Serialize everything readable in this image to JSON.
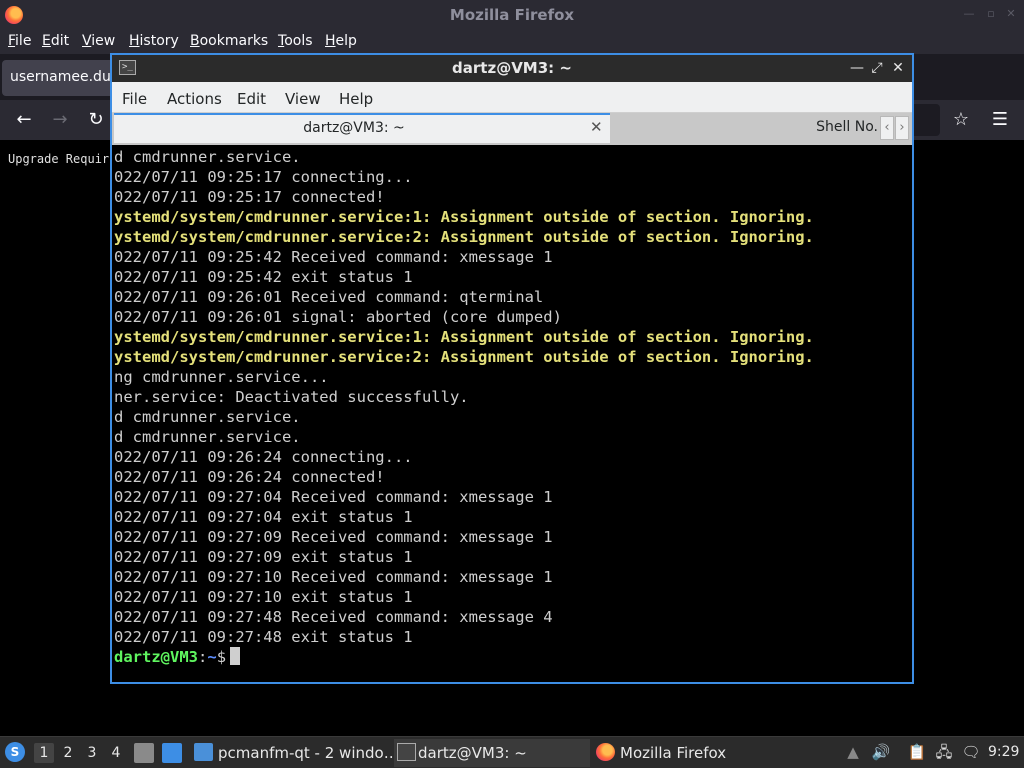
{
  "firefox": {
    "title": "Mozilla Firefox",
    "menu": [
      "File",
      "Edit",
      "View",
      "History",
      "Bookmarks",
      "Tools",
      "Help"
    ],
    "tab_label": "usernamee.duc",
    "page_text": "Upgrade Requir"
  },
  "terminal": {
    "title": "dartz@VM3: ~",
    "menu": [
      "File",
      "Actions",
      "Edit",
      "View",
      "Help"
    ],
    "tab_active_label": "dartz@VM3: ~",
    "tab_second_label": "Shell No.",
    "lines": [
      {
        "text": "d cmdrunner.service.",
        "style": "normal"
      },
      {
        "text": "022/07/11 09:25:17 connecting...",
        "style": "normal"
      },
      {
        "text": "022/07/11 09:25:17 connected!",
        "style": "normal"
      },
      {
        "text": "ystemd/system/cmdrunner.service:1: Assignment outside of section. Ignoring.",
        "style": "warn"
      },
      {
        "text": "ystemd/system/cmdrunner.service:2: Assignment outside of section. Ignoring.",
        "style": "warn"
      },
      {
        "text": "022/07/11 09:25:42 Received command: xmessage 1",
        "style": "normal"
      },
      {
        "text": "022/07/11 09:25:42 exit status 1",
        "style": "normal"
      },
      {
        "text": "022/07/11 09:26:01 Received command: qterminal",
        "style": "normal"
      },
      {
        "text": "022/07/11 09:26:01 signal: aborted (core dumped)",
        "style": "normal"
      },
      {
        "text": "ystemd/system/cmdrunner.service:1: Assignment outside of section. Ignoring.",
        "style": "warn"
      },
      {
        "text": "ystemd/system/cmdrunner.service:2: Assignment outside of section. Ignoring.",
        "style": "warn"
      },
      {
        "text": "ng cmdrunner.service...",
        "style": "normal"
      },
      {
        "text": "ner.service: Deactivated successfully.",
        "style": "normal"
      },
      {
        "text": "d cmdrunner.service.",
        "style": "normal"
      },
      {
        "text": "d cmdrunner.service.",
        "style": "normal"
      },
      {
        "text": "022/07/11 09:26:24 connecting...",
        "style": "normal"
      },
      {
        "text": "022/07/11 09:26:24 connected!",
        "style": "normal"
      },
      {
        "text": "022/07/11 09:27:04 Received command: xmessage 1",
        "style": "normal"
      },
      {
        "text": "022/07/11 09:27:04 exit status 1",
        "style": "normal"
      },
      {
        "text": "022/07/11 09:27:09 Received command: xmessage 1",
        "style": "normal"
      },
      {
        "text": "022/07/11 09:27:09 exit status 1",
        "style": "normal"
      },
      {
        "text": "022/07/11 09:27:10 Received command: xmessage 1",
        "style": "normal"
      },
      {
        "text": "022/07/11 09:27:10 exit status 1",
        "style": "normal"
      },
      {
        "text": "022/07/11 09:27:48 Received command: xmessage 4",
        "style": "normal"
      },
      {
        "text": "022/07/11 09:27:48 exit status 1",
        "style": "normal"
      }
    ],
    "prompt": {
      "user": "dartz@VM3",
      "sep": ":",
      "path": "~",
      "symbol": "$"
    }
  },
  "taskbar": {
    "workspaces": [
      "1",
      "2",
      "3",
      "4"
    ],
    "tasks": [
      {
        "label": "pcmanfm-qt - 2 windo…",
        "icon": "folder-icon"
      },
      {
        "label": "dartz@VM3: ~",
        "icon": "terminal-icon"
      },
      {
        "label": "Mozilla Firefox",
        "icon": "firefox-icon"
      }
    ],
    "clock": "9:29"
  },
  "colors": {
    "accent": "#3d8ee5",
    "warn_text": "#e4e07a",
    "prompt_user": "#5ff55f",
    "prompt_path": "#5f8fff"
  }
}
